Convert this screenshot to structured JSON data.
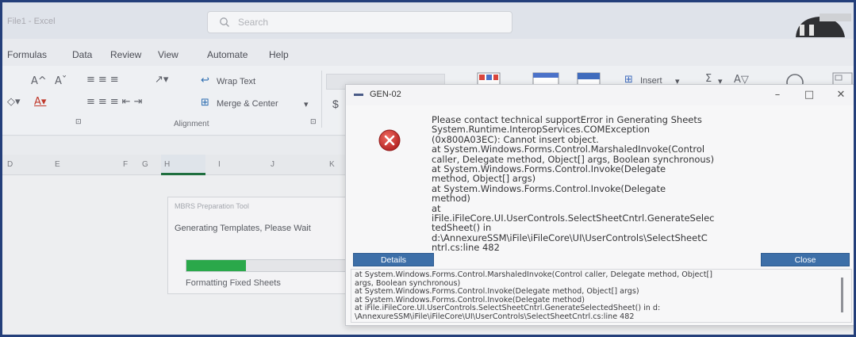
{
  "excel": {
    "title": "File1 - Excel",
    "search_placeholder": "Search",
    "menu": [
      "Formulas",
      "Data",
      "Review",
      "View",
      "Automate",
      "Help"
    ],
    "ribbon": {
      "wrap_text": "Wrap Text",
      "merge_center": "Merge & Center",
      "alignment_group": "Alignment",
      "insert": "Insert",
      "currency": "$",
      "sum": "Σ",
      "font_grow": "A^",
      "font_shrink": "Aˇ"
    },
    "columns": [
      "D",
      "E",
      "F",
      "G",
      "H",
      "I",
      "J",
      "K"
    ]
  },
  "progress_dialog": {
    "title": "MBRS Preparation Tool",
    "message": "Generating Templates, Please Wait",
    "progress_fraction": 0.35,
    "status": "Formatting Fixed Sheets"
  },
  "error_dialog": {
    "title": "GEN-02",
    "message": "Please contact technical supportError in Generating Sheets\nSystem.Runtime.InteropServices.COMException\n(0x800A03EC): Cannot insert object.\n   at System.Windows.Forms.Control.MarshaledInvoke(Control\ncaller, Delegate method, Object[] args, Boolean synchronous)\n   at System.Windows.Forms.Control.Invoke(Delegate\nmethod, Object[] args)\n   at System.Windows.Forms.Control.Invoke(Delegate\nmethod)\n   at\niFile.iFileCore.UI.UserControls.SelectSheetCntrl.GenerateSelec\ntedSheet() in\nd:\\AnnexureSSM\\iFile\\iFileCore\\UI\\UserControls\\SelectSheetC\nntrl.cs:line 482",
    "details_button": "Details",
    "close_button": "Close",
    "details_text": "   at System.Windows.Forms.Control.MarshaledInvoke(Control caller, Delegate method, Object[]\nargs, Boolean synchronous)\n   at System.Windows.Forms.Control.Invoke(Delegate method, Object[] args)\n   at System.Windows.Forms.Control.Invoke(Delegate method)\n   at iFile.iFileCore.UI.UserControls.SelectSheetCntrl.GenerateSelectedSheet() in d:\n\\AnnexureSSM\\iFile\\iFileCore\\UI\\UserControls\\SelectSheetCntrl.cs:line 482",
    "minimize_glyph": "–",
    "maximize_glyph": "□",
    "close_glyph": "✕"
  },
  "colors": {
    "accent_blue": "#3d6fa8",
    "progress_green": "#2aa84a",
    "error_red": "#c8302f",
    "frame_blue": "#243f7a"
  },
  "icons": [
    "search-icon",
    "error-icon",
    "app-icon"
  ]
}
